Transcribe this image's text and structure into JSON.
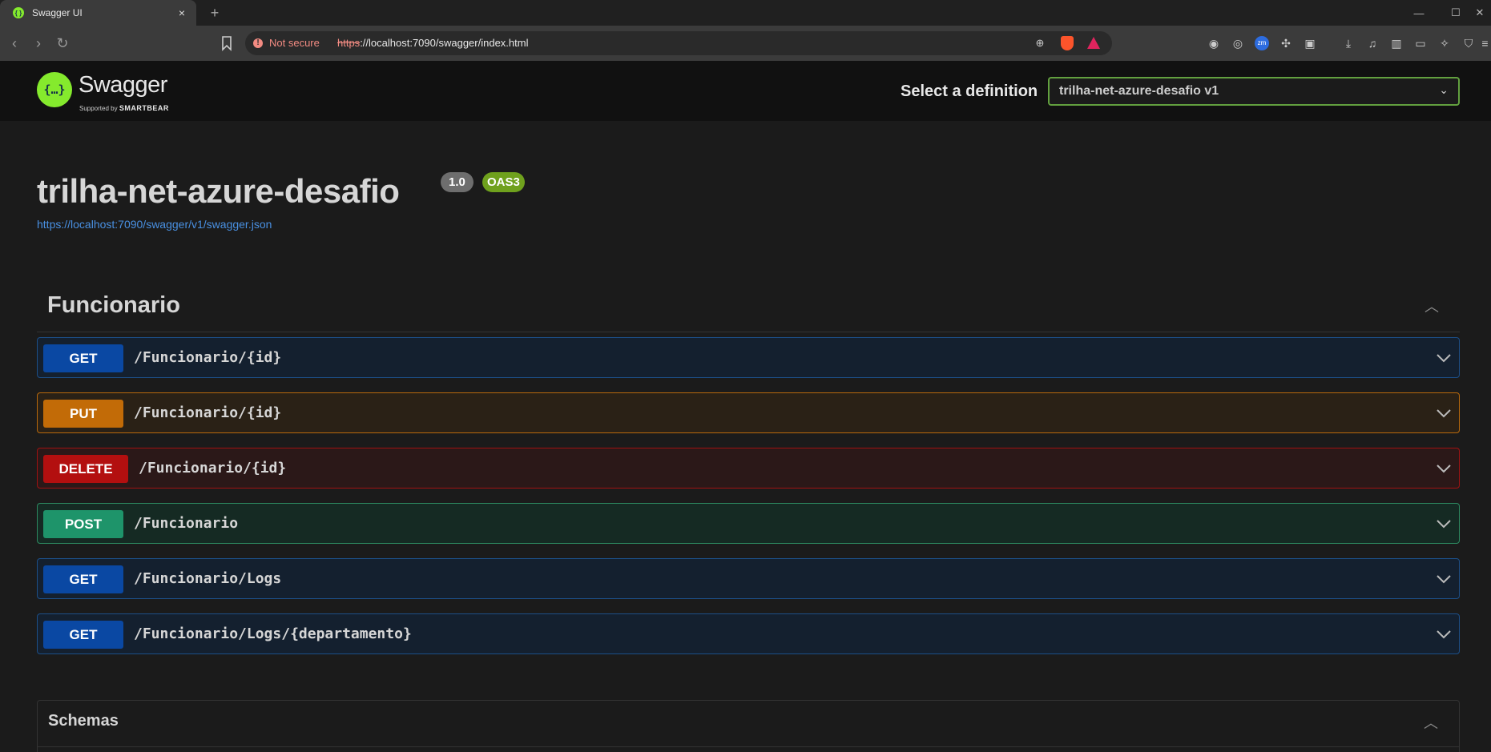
{
  "browser": {
    "tab_title": "Swagger UI",
    "not_secure": "Not secure",
    "url_scheme": "https",
    "url_rest": "://localhost:7090/swagger/index.html"
  },
  "topbar": {
    "logo_text": "Swagger",
    "logo_sub_prefix": "Supported by",
    "logo_sub_brand": "SMARTBEAR",
    "select_label": "Select a definition",
    "select_value": "trilha-net-azure-desafio v1"
  },
  "info": {
    "title": "trilha-net-azure-desafio",
    "version": "1.0",
    "oas": "OAS3",
    "spec_url": "https://localhost:7090/swagger/v1/swagger.json"
  },
  "tag": {
    "name": "Funcionario"
  },
  "operations": [
    {
      "method": "GET",
      "path": "/Funcionario/{id}"
    },
    {
      "method": "PUT",
      "path": "/Funcionario/{id}"
    },
    {
      "method": "DELETE",
      "path": "/Funcionario/{id}"
    },
    {
      "method": "POST",
      "path": "/Funcionario"
    },
    {
      "method": "GET",
      "path": "/Funcionario/Logs"
    },
    {
      "method": "GET",
      "path": "/Funcionario/Logs/{departamento}"
    }
  ],
  "schemas": {
    "title": "Schemas"
  },
  "colors": {
    "get": "#0a48a3",
    "put": "#c26b07",
    "delete": "#b30f0f",
    "post": "#1e946a",
    "brand": "#85ea2d"
  }
}
